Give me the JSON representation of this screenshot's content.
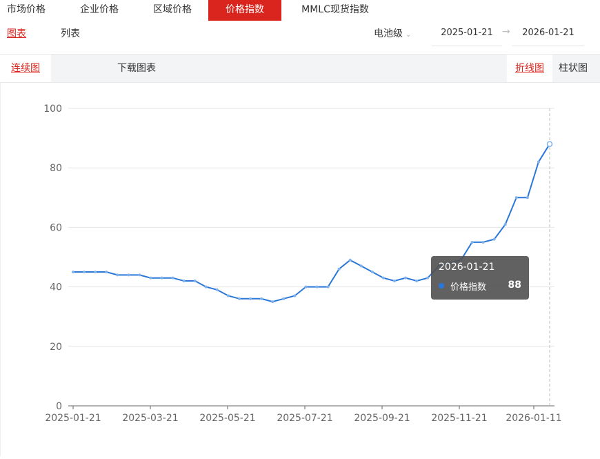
{
  "tabs": [
    {
      "label": "市场价格",
      "active": false
    },
    {
      "label": "企业价格",
      "active": false
    },
    {
      "label": "区域价格",
      "active": false
    },
    {
      "label": "价格指数",
      "active": true
    },
    {
      "label": "MMLC现货指数",
      "active": false
    }
  ],
  "view_mode": {
    "chart_label": "图表",
    "list_label": "列表"
  },
  "filter": {
    "grade_label": "电池级",
    "start_date": "2025-01-21",
    "end_date": "2026-01-21"
  },
  "toolbar": {
    "continuous_label": "连续图",
    "download_label": "下载图表",
    "line_label": "折线图",
    "bar_label": "柱状图"
  },
  "tooltip": {
    "date": "2026-01-21",
    "series_name": "价格指数",
    "value": "88"
  },
  "colors": {
    "accent": "#d9251d",
    "series": "#2a76d9"
  },
  "chart_data": {
    "type": "line",
    "series": [
      {
        "name": "价格指数",
        "values": [
          45,
          45,
          45,
          45,
          44,
          44,
          44,
          43,
          43,
          43,
          42,
          42,
          40,
          39,
          37,
          36,
          36,
          36,
          35,
          36,
          37,
          40,
          40,
          40,
          46,
          49,
          47,
          45,
          43,
          42,
          43,
          42,
          43,
          47,
          48,
          49,
          55,
          55,
          56,
          61,
          70,
          70,
          82,
          88
        ]
      }
    ],
    "x_ticks": [
      "2025-01-21",
      "2025-03-21",
      "2025-05-21",
      "2025-07-21",
      "2025-09-21",
      "2025-11-21",
      "2026-01-11"
    ],
    "y_ticks": [
      0,
      20,
      40,
      60,
      80,
      100
    ],
    "ylim": [
      0,
      100
    ],
    "grid": true
  }
}
